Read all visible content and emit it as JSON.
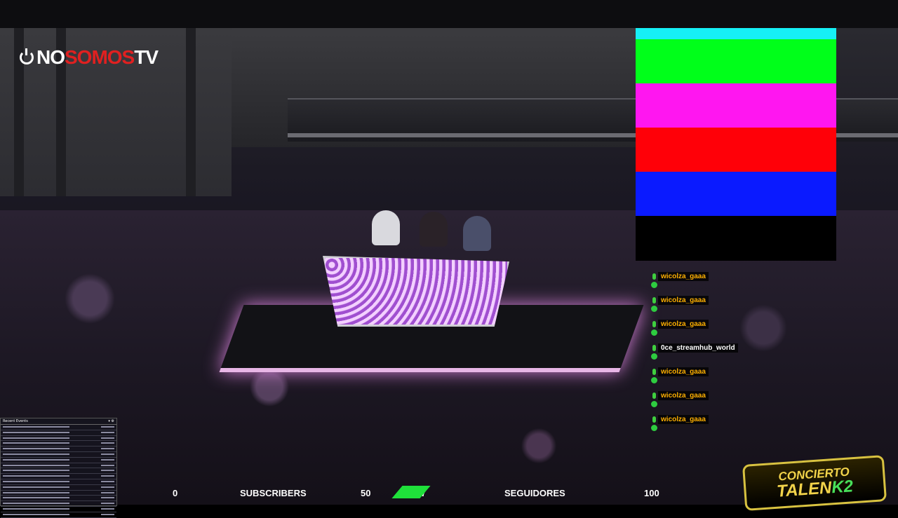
{
  "logo": {
    "part1": "NO",
    "part2": "SOMOS",
    "part3": "TV",
    "accent": "#e02020"
  },
  "color_bars": [
    "#16f0f6",
    "#00ff1a",
    "#ff16f0",
    "#ff0008",
    "#0a1aff",
    "#000000"
  ],
  "chat": {
    "messages": [
      {
        "user": "wicolza_gaaa",
        "color": "#ffb000",
        "badge": "#2ecc40"
      },
      {
        "user": "wicolza_gaaa",
        "color": "#ffb000",
        "badge": "#2ecc40"
      },
      {
        "user": "wicolza_gaaa",
        "color": "#ffb000",
        "badge": "#2ecc40"
      },
      {
        "user": "0ce_streamhub_world",
        "color": "#ffffff",
        "badge": "#2ecc40"
      },
      {
        "user": "wicolza_gaaa",
        "color": "#ffb000",
        "badge": "#2ecc40"
      },
      {
        "user": "wicolza_gaaa",
        "color": "#ffb000",
        "badge": "#2ecc40"
      },
      {
        "user": "wicolza_gaaa",
        "color": "#ffb000",
        "badge": "#2ecc40"
      }
    ]
  },
  "recent_events": {
    "title": "Recent Events"
  },
  "stats_bar": {
    "subs_count": "0",
    "subs_label": "SUBSCRIBERS",
    "subs_goal": "50",
    "followers_count": "7",
    "followers_label": "SEGUIDORES",
    "followers_goal": "100",
    "accent": "#1fe03a"
  },
  "brand": {
    "line1": "CONCIERTO",
    "line2": "TALEN",
    "suffix": "K2"
  }
}
